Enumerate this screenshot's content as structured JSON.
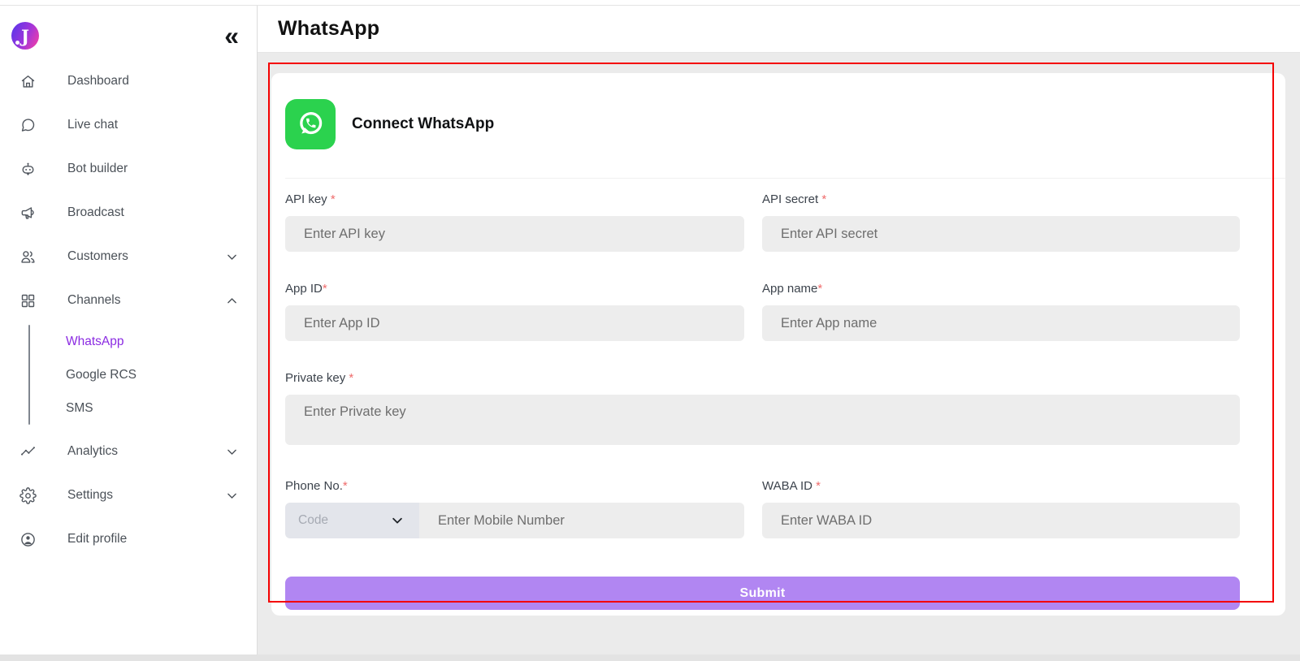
{
  "header": {
    "title": "WhatsApp"
  },
  "sidebar": {
    "logo_letter": "J",
    "collapse_icon": "«",
    "items": [
      {
        "label": "Dashboard",
        "icon": "home-icon"
      },
      {
        "label": "Live chat",
        "icon": "chat-bubble-icon"
      },
      {
        "label": "Bot builder",
        "icon": "robot-icon"
      },
      {
        "label": "Broadcast",
        "icon": "megaphone-icon"
      },
      {
        "label": "Customers",
        "icon": "users-icon",
        "chevron": "down"
      },
      {
        "label": "Channels",
        "icon": "grid-icon",
        "chevron": "up",
        "expanded": true
      },
      {
        "label": "Analytics",
        "icon": "trend-icon",
        "chevron": "down"
      },
      {
        "label": "Settings",
        "icon": "gear-icon",
        "chevron": "down"
      },
      {
        "label": "Edit profile",
        "icon": "profile-icon"
      }
    ],
    "channel_subitems": [
      {
        "label": "WhatsApp",
        "active": true
      },
      {
        "label": "Google RCS",
        "active": false
      },
      {
        "label": "SMS",
        "active": false
      }
    ]
  },
  "panel": {
    "title": "Connect WhatsApp",
    "icon": "whatsapp-icon",
    "required_mark": "*",
    "fields": {
      "api_key": {
        "label": "API key ",
        "placeholder": "Enter API key"
      },
      "api_secret": {
        "label": "API secret ",
        "placeholder": "Enter API secret"
      },
      "app_id": {
        "label": "App ID",
        "placeholder": "Enter App ID"
      },
      "app_name": {
        "label": "App name",
        "placeholder": "Enter App name"
      },
      "private_key": {
        "label": "Private key ",
        "placeholder": "Enter Private key"
      },
      "phone": {
        "label": "Phone No.",
        "code_placeholder": "Code",
        "placeholder": "Enter Mobile Number"
      },
      "waba_id": {
        "label": "WABA ID ",
        "placeholder": "Enter WABA ID"
      }
    },
    "submit_label": "Submit"
  },
  "colors": {
    "accent_purple": "#8b2be2",
    "submit_purple": "#b186f2",
    "whatsapp_green": "#2bd24e",
    "annotation_red": "#f40000",
    "input_bg": "#ededed",
    "code_select_bg": "#e3e5eb",
    "main_bg": "#ebebeb"
  }
}
